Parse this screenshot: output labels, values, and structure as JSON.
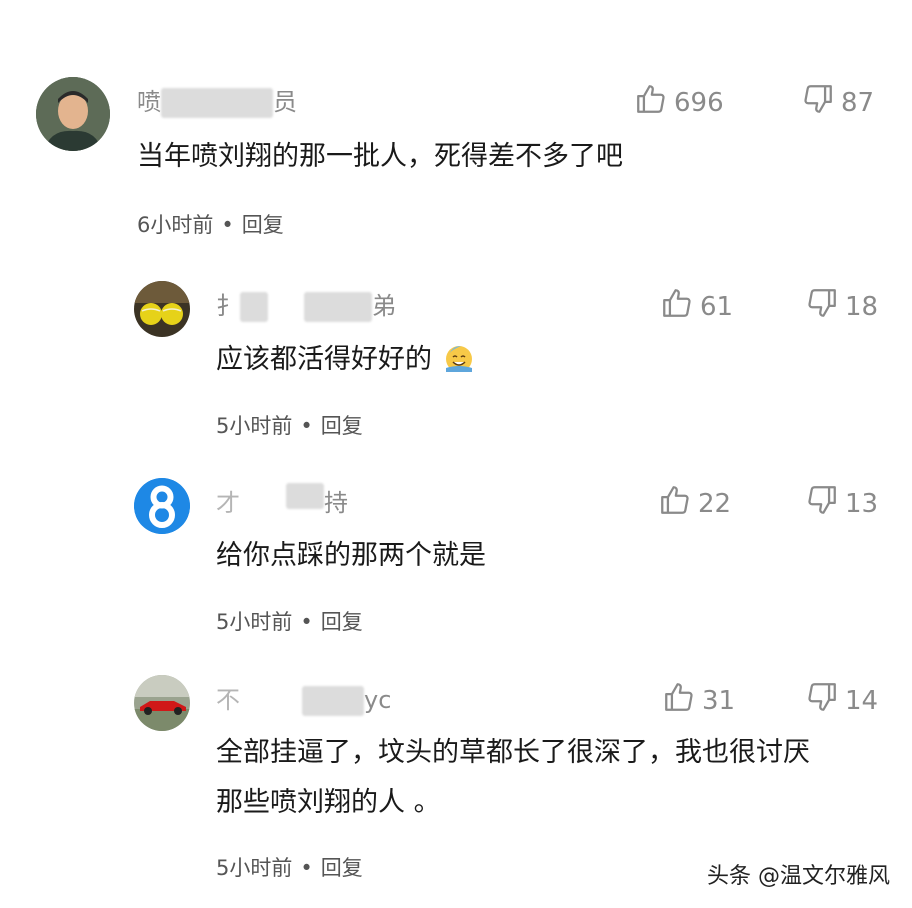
{
  "comments": [
    {
      "name_start": "喷",
      "name_end": "员",
      "text": "当年喷刘翔的那一批人，死得差不多了吧",
      "time": "6小时前",
      "reply": "回复",
      "likes": "696",
      "dislikes": "87"
    },
    {
      "name_start": "扌",
      "name_end": "弟",
      "text": "应该都活得好好的",
      "time": "5小时前",
      "reply": "回复",
      "likes": "61",
      "dislikes": "18"
    },
    {
      "name_start": "才",
      "name_end": "持",
      "text": "给你点踩的那两个就是",
      "time": "5小时前",
      "reply": "回复",
      "likes": "22",
      "dislikes": "13"
    },
    {
      "name_start": "不",
      "name_end": "yc",
      "text_line1": "全部挂逼了，坟头的草都长了很深了，我也很讨厌",
      "text_line2": "那些喷刘翔的人 。",
      "time": "5小时前",
      "reply": "回复",
      "likes": "31",
      "dislikes": "14"
    }
  ],
  "separator": "•",
  "watermark": "头条 @温文尔雅风",
  "icons": {
    "like": "thumbs-up-icon",
    "dislike": "thumbs-down-icon",
    "emoji": "sweat-smile-emoji-icon"
  },
  "colors": {
    "name": "#8a8a8a",
    "text": "#1a1a1a",
    "icon": "#8a8a8a",
    "avatar_blue": "#1e88e5"
  }
}
